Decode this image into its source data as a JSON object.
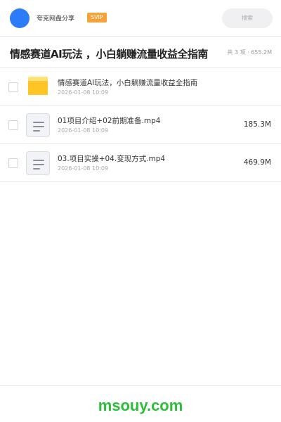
{
  "header": {
    "user_name": "夸克网盘分享",
    "badge": "SVIP",
    "search_placeholder": "搜索",
    "accent_color": "#2b7cf6",
    "badge_color": "#f5a338"
  },
  "title_bar": {
    "title": "情感赛道AI玩法 ，小白躺赚流量收益全指南",
    "summary": "共 3 项 · 655.2M"
  },
  "files": [
    {
      "type": "folder-icon",
      "name": "情感赛道AI玩法，小白躺赚流量收益全指南",
      "date": "2026-01-08 10:09",
      "size": ""
    },
    {
      "type": "document-icon",
      "name": "01项目介绍+02前期准备.mp4",
      "date": "2026-01-08 10:09",
      "size": "185.3M"
    },
    {
      "type": "document-icon",
      "name": "03.项目实操+04.变现方式.mp4",
      "date": "2026-01-08 10:09",
      "size": "469.9M"
    }
  ],
  "footer": {
    "watermark": "msouy.com",
    "watermark_color": "#2ebd3a"
  }
}
